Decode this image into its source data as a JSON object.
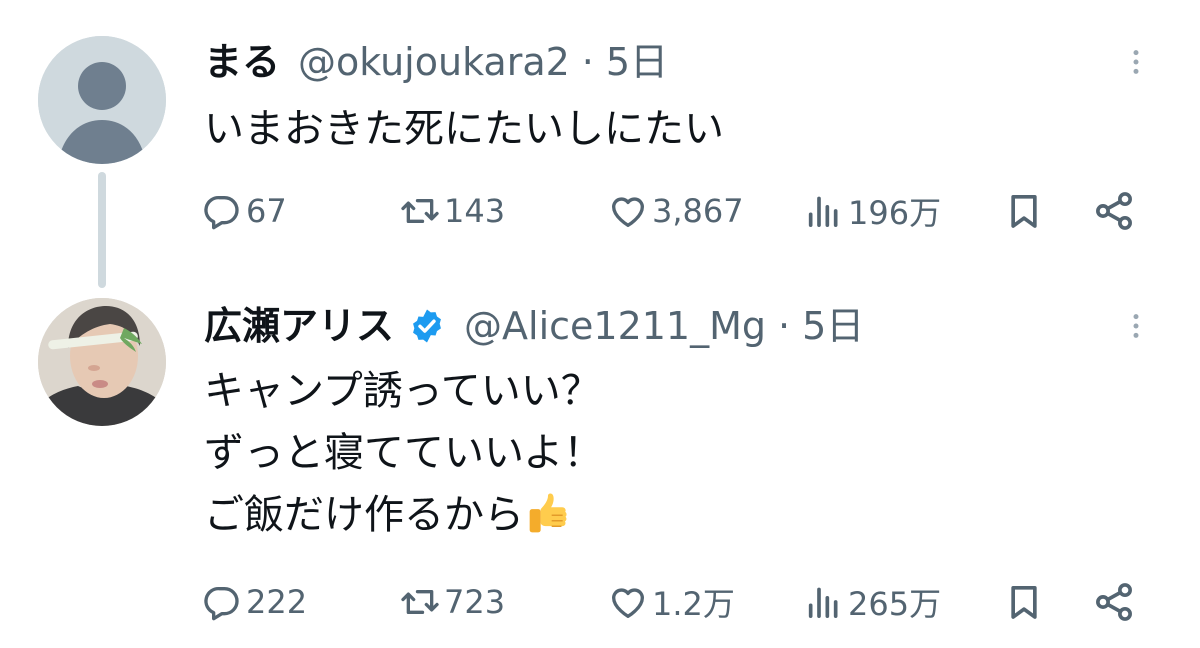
{
  "tweets": [
    {
      "display_name": "まる",
      "handle": "@okujoukara2",
      "separator": "·",
      "time": "5日",
      "verified": false,
      "avatar": "default-avatar",
      "text_lines": [
        "いまおきた死にたいしにたい"
      ],
      "stats": {
        "replies": "67",
        "retweets": "143",
        "likes": "3,867",
        "views": "196万"
      }
    },
    {
      "display_name": "広瀬アリス",
      "handle": "@Alice1211_Mg",
      "separator": "·",
      "time": "5日",
      "verified": true,
      "avatar": "profile-photo",
      "text_lines": [
        "キャンプ誘っていい？",
        "ずっと寝てていいよ！",
        "ご飯だけ作るから"
      ],
      "emoji": "thumbs-up",
      "stats": {
        "replies": "222",
        "retweets": "723",
        "likes": "1.2万",
        "views": "265万"
      }
    }
  ],
  "colors": {
    "text": "#0f1419",
    "secondary": "#536471",
    "verified": "#1d9bf0",
    "thread_line": "#cfd9de",
    "default_avatar_bg": "#cfd9de",
    "default_avatar_figure": "#6f7f8f"
  },
  "icons": {
    "reply": "speech-bubble-icon",
    "retweet": "retweet-arrows-icon",
    "like": "heart-icon",
    "views": "bar-chart-icon",
    "bookmark": "bookmark-icon",
    "share": "share-nodes-icon",
    "more": "vertical-ellipsis-icon"
  }
}
